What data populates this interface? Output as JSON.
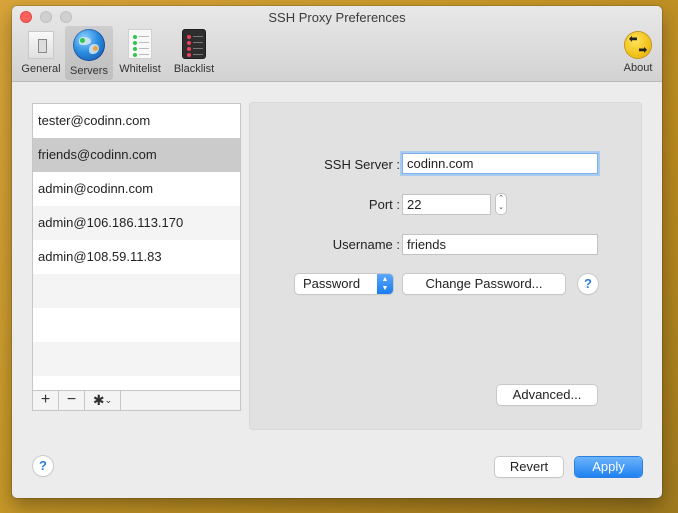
{
  "window": {
    "title": "SSH Proxy Preferences"
  },
  "toolbar": {
    "items": [
      {
        "label": "General",
        "icon": "switch-icon",
        "selected": false
      },
      {
        "label": "Servers",
        "icon": "globe-icon",
        "selected": true
      },
      {
        "label": "Whitelist",
        "icon": "whitelist-icon",
        "selected": false
      },
      {
        "label": "Blacklist",
        "icon": "blacklist-icon",
        "selected": false
      }
    ],
    "about_label": "About"
  },
  "servers": {
    "items": [
      "tester@codinn.com",
      "friends@codinn.com",
      "admin@codinn.com",
      "admin@106.186.113.170",
      "admin@108.59.11.83"
    ],
    "selected_index": 1,
    "add_label": "+",
    "remove_label": "−",
    "gear_label": "✱"
  },
  "detail": {
    "ssh_server_label": "SSH Server :",
    "ssh_server_value": "codinn.com",
    "port_label": "Port :",
    "port_value": "22",
    "username_label": "Username :",
    "username_value": "friends",
    "auth_method": "Password",
    "change_password_label": "Change Password...",
    "help_label": "?",
    "advanced_label": "Advanced..."
  },
  "footer": {
    "help_label": "?",
    "revert_label": "Revert",
    "apply_label": "Apply"
  },
  "colors": {
    "accent": "#1f82f2",
    "selection": "#cbcbcb",
    "close": "#fc605b"
  }
}
